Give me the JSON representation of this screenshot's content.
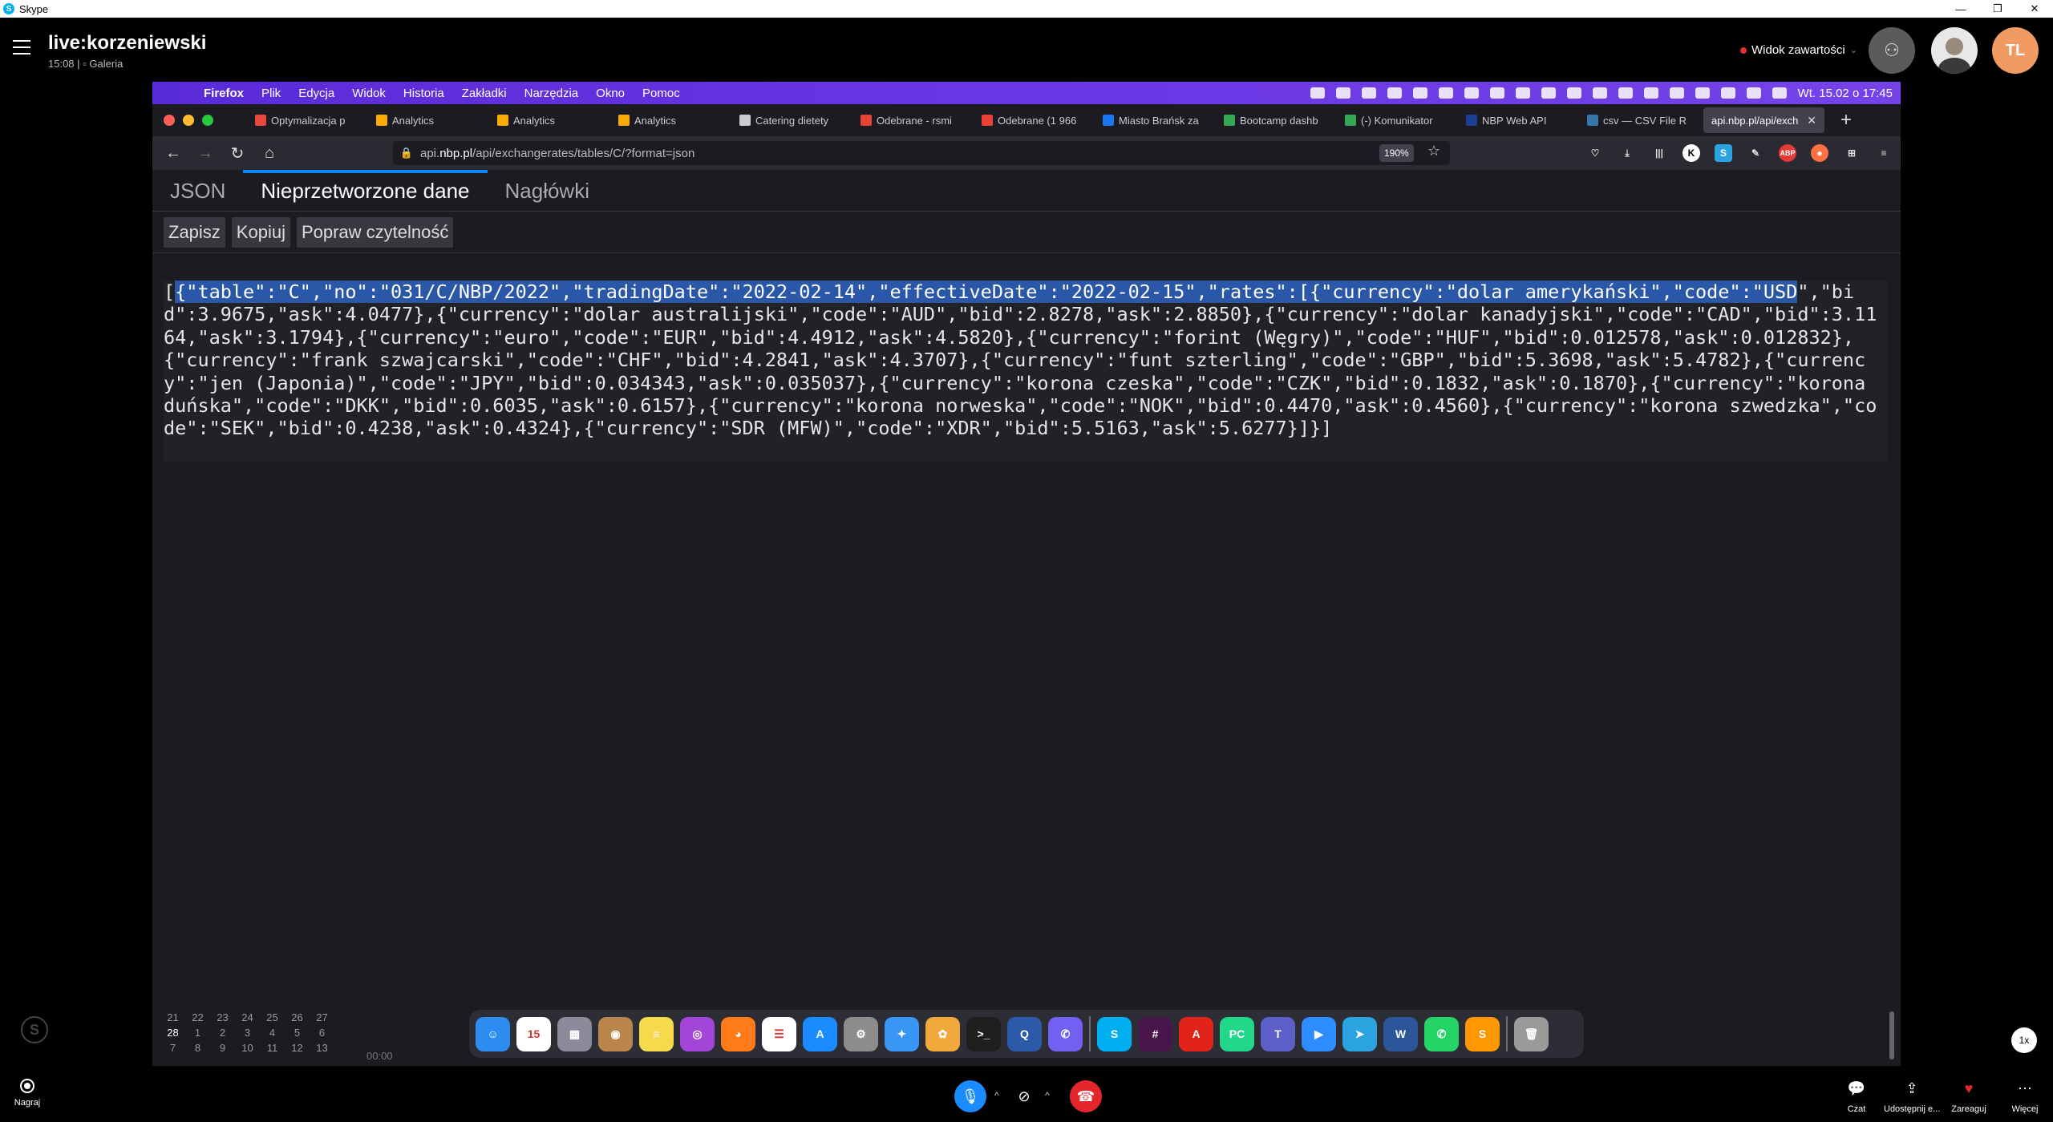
{
  "window": {
    "title": "Skype"
  },
  "call": {
    "title": "live:korzeniewski",
    "time": "15:08",
    "sep": "|",
    "gallery": "Galeria",
    "content_view": "Widok zawartości",
    "participant_initials": "TL"
  },
  "mac_menu": [
    "Firefox",
    "Plik",
    "Edycja",
    "Widok",
    "Historia",
    "Zakładki",
    "Narzędzia",
    "Okno",
    "Pomoc"
  ],
  "mac_clock": "Wt. 15.02 o  17:45",
  "tabs": [
    {
      "label": "Optymalizacja p",
      "color": "#e8483a"
    },
    {
      "label": "Analytics",
      "color": "#f9ab00"
    },
    {
      "label": "Analytics",
      "color": "#f9ab00"
    },
    {
      "label": "Analytics",
      "color": "#f9ab00"
    },
    {
      "label": "Catering dietety",
      "color": "#cccccc"
    },
    {
      "label": "Odebrane - rsmi",
      "color": "#ea4335"
    },
    {
      "label": "Odebrane (1 966",
      "color": "#ea4335"
    },
    {
      "label": "Miasto Brańsk za",
      "color": "#1877f2"
    },
    {
      "label": "Bootcamp dashb",
      "color": "#34a853"
    },
    {
      "label": "(-) Komunikator",
      "color": "#34a853"
    },
    {
      "label": "NBP Web API",
      "color": "#1c3f94"
    },
    {
      "label": "csv — CSV File R",
      "color": "#3776ab"
    }
  ],
  "active_tab": {
    "label": "api.nbp.pl/api/exch",
    "close": "✕"
  },
  "url": {
    "prefix": "api.",
    "domain": "nbp.pl",
    "path": "/api/exchangerates/tables/C/?format=json",
    "zoom": "190%"
  },
  "viewer_tabs": [
    "JSON",
    "Nieprzetworzone dane",
    "Nagłówki"
  ],
  "viewer_buttons": [
    "Zapisz",
    "Kopiuj",
    "Popraw czytelność"
  ],
  "raw": {
    "open": "[",
    "selected": "{\"table\":\"C\",\"no\":\"031/C/NBP/2022\",\"tradingDate\":\"2022-02-14\",\"effectiveDate\":\"2022-02-15\",\"rates\":[{\"currency\":\"dolar amerykański\",\"code\":\"USD",
    "rest": "\",\"bid\":3.9675,\"ask\":4.0477},{\"currency\":\"dolar australijski\",\"code\":\"AUD\",\"bid\":2.8278,\"ask\":2.8850},{\"currency\":\"dolar kanadyjski\",\"code\":\"CAD\",\"bid\":3.1164,\"ask\":3.1794},{\"currency\":\"euro\",\"code\":\"EUR\",\"bid\":4.4912,\"ask\":4.5820},{\"currency\":\"forint (Węgry)\",\"code\":\"HUF\",\"bid\":0.012578,\"ask\":0.012832},{\"currency\":\"frank szwajcarski\",\"code\":\"CHF\",\"bid\":4.2841,\"ask\":4.3707},{\"currency\":\"funt szterling\",\"code\":\"GBP\",\"bid\":5.3698,\"ask\":5.4782},{\"currency\":\"jen (Japonia)\",\"code\":\"JPY\",\"bid\":0.034343,\"ask\":0.035037},{\"currency\":\"korona czeska\",\"code\":\"CZK\",\"bid\":0.1832,\"ask\":0.1870},{\"currency\":\"korona duńska\",\"code\":\"DKK\",\"bid\":0.6035,\"ask\":0.6157},{\"currency\":\"korona norweska\",\"code\":\"NOK\",\"bid\":0.4470,\"ask\":0.4560},{\"currency\":\"korona szwedzka\",\"code\":\"SEK\",\"bid\":0.4238,\"ask\":0.4324},{\"currency\":\"SDR (MFW)\",\"code\":\"XDR\",\"bid\":5.5163,\"ask\":5.6277}]}]"
  },
  "mini_cal": [
    "21",
    "22",
    "23",
    "24",
    "25",
    "26",
    "27",
    "28",
    "1",
    "2",
    "3",
    "4",
    "5",
    "6",
    "7",
    "8",
    "9",
    "10",
    "11",
    "12",
    "13"
  ],
  "mini_time": "00:00",
  "dock": [
    {
      "name": "finder",
      "color": "#2d8cf0",
      "glyph": "☺"
    },
    {
      "name": "calendar",
      "color": "#ffffff",
      "glyph": "15"
    },
    {
      "name": "launchpad",
      "color": "#8a8a9a",
      "glyph": "▦"
    },
    {
      "name": "contacts",
      "color": "#b9854a",
      "glyph": "◉"
    },
    {
      "name": "notes",
      "color": "#f7d94c",
      "glyph": "≡"
    },
    {
      "name": "podcasts",
      "color": "#a245d8",
      "glyph": "◎"
    },
    {
      "name": "firefox",
      "color": "#ff7a18",
      "glyph": "◕"
    },
    {
      "name": "reminders",
      "color": "#ffffff",
      "glyph": "☰"
    },
    {
      "name": "app-store",
      "color": "#1a8cff",
      "glyph": "A"
    },
    {
      "name": "system-preferences",
      "color": "#8c8c8c",
      "glyph": "⚙"
    },
    {
      "name": "safari",
      "color": "#3a96f5",
      "glyph": "✦"
    },
    {
      "name": "photos",
      "color": "#f2a93b",
      "glyph": "✿"
    },
    {
      "name": "terminal",
      "color": "#1e1e1e",
      "glyph": ">_"
    },
    {
      "name": "quicktime",
      "color": "#2a5aa8",
      "glyph": "Q"
    },
    {
      "name": "viber",
      "color": "#7360f2",
      "glyph": "✆"
    },
    {
      "name": "skype",
      "color": "#00aff0",
      "glyph": "S"
    },
    {
      "name": "slack",
      "color": "#4a154b",
      "glyph": "#"
    },
    {
      "name": "acrobat",
      "color": "#e2231a",
      "glyph": "A"
    },
    {
      "name": "pycharm",
      "color": "#21d789",
      "glyph": "PC"
    },
    {
      "name": "teams",
      "color": "#5b5fc7",
      "glyph": "T"
    },
    {
      "name": "zoom",
      "color": "#2d8cff",
      "glyph": "▶"
    },
    {
      "name": "telegram",
      "color": "#2aa3e0",
      "glyph": "➤"
    },
    {
      "name": "word",
      "color": "#2b579a",
      "glyph": "W"
    },
    {
      "name": "whatsapp",
      "color": "#25d366",
      "glyph": "✆"
    },
    {
      "name": "sublime",
      "color": "#ff9800",
      "glyph": "S"
    },
    {
      "name": "trash",
      "color": "#9a9a9a",
      "glyph": "🗑"
    }
  ],
  "bottom": {
    "record": "Nagraj",
    "chat": "Czat",
    "share": "Udostępnij e...",
    "react": "Zareaguj",
    "more": "Więcej",
    "speed": "1x"
  }
}
